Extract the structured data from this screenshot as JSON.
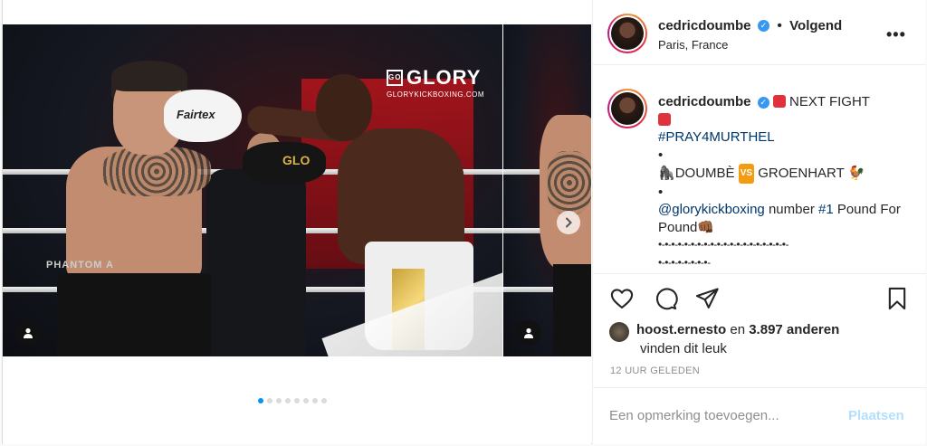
{
  "post": {
    "username": "cedricdoumbe",
    "verified_icon": "verified-badge-icon",
    "separator": "•",
    "follow_status": "Volgend",
    "location": "Paris, France",
    "more_icon": "more-options-icon"
  },
  "media": {
    "watermark_brand": "GLORY",
    "watermark_site": "GLORYKICKBOXING.COM",
    "watermark_logo_text": "GO",
    "shorts_text": "PHANTOM A",
    "glove_text": "GLO",
    "white_glove_text": "Fairtex",
    "carousel_count": 8,
    "carousel_active": 0
  },
  "caption": {
    "username": "cedricdoumbe",
    "line1": " NEXT FIGHT",
    "hashtag1": "#PRAY4MURTHEL",
    "bullet": "•",
    "fight_left": "DOUMBÈ",
    "vs": "VS",
    "fight_right": "GROENHART",
    "mention": "@glorykickboxing",
    "rank_prefix": " number ",
    "rank_tag": "#1",
    "rank_suffix": " Pound For Pound",
    "divider1": "•-•-•-•-•-•-•-•-•-•-•-•-•-•-•-•-•-•-•-•-",
    "divider2": "•-•-•-•-•-•-•-•-"
  },
  "actions": {
    "like_icon": "heart-icon",
    "comment_icon": "comment-icon",
    "share_icon": "share-icon",
    "save_icon": "bookmark-icon"
  },
  "likes": {
    "liker": "hoost.ernesto",
    "connector": " en ",
    "count": "3.897 anderen",
    "suffix": "vinden dit leuk"
  },
  "timestamp": "12 UUR GELEDEN",
  "comment": {
    "placeholder": "Een opmerking toevoegen...",
    "post_label": "Plaatsen"
  },
  "colors": {
    "accent": "#0095f6",
    "post_disabled": "#b2dffc",
    "hashtag": "#00376b",
    "muted": "#8e8e8e"
  }
}
